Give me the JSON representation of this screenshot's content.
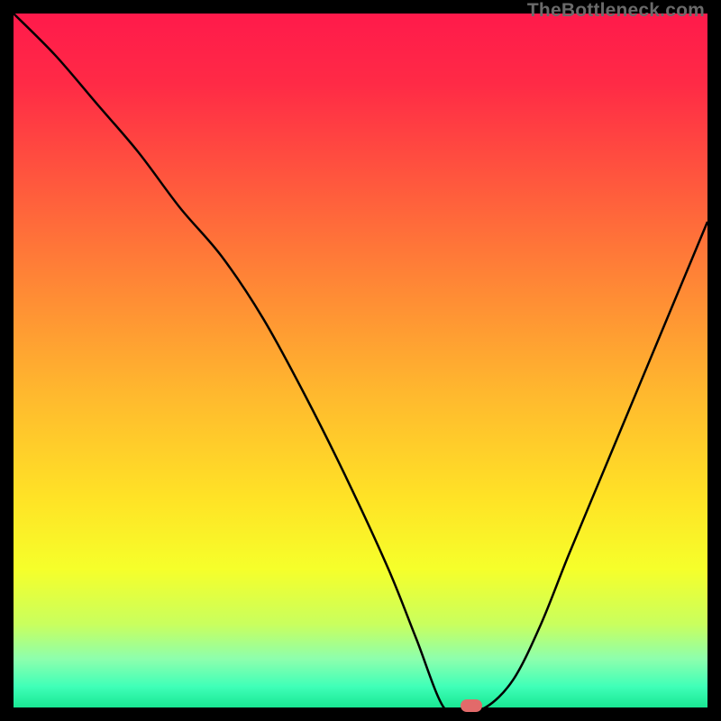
{
  "watermark": "TheBottleneck.com",
  "colors": {
    "background": "#000000",
    "gradient_stops": [
      {
        "offset": 0.0,
        "color": "#ff1a4b"
      },
      {
        "offset": 0.1,
        "color": "#ff2a46"
      },
      {
        "offset": 0.25,
        "color": "#ff5a3d"
      },
      {
        "offset": 0.4,
        "color": "#ff8a35"
      },
      {
        "offset": 0.55,
        "color": "#ffb92e"
      },
      {
        "offset": 0.7,
        "color": "#ffe326"
      },
      {
        "offset": 0.8,
        "color": "#f6ff2a"
      },
      {
        "offset": 0.88,
        "color": "#c9ff5e"
      },
      {
        "offset": 0.93,
        "color": "#8dffad"
      },
      {
        "offset": 0.97,
        "color": "#3fffb8"
      },
      {
        "offset": 1.0,
        "color": "#19e793"
      }
    ],
    "curve": "#000000",
    "marker": "#e26a6a"
  },
  "chart_data": {
    "type": "line",
    "title": "",
    "xlabel": "",
    "ylabel": "",
    "xlim": [
      0,
      100
    ],
    "ylim": [
      0,
      100
    ],
    "series": [
      {
        "name": "bottleneck-curve",
        "x": [
          0,
          6,
          12,
          18,
          24,
          30,
          36,
          42,
          48,
          54,
          58,
          62,
          65,
          68,
          72,
          76,
          80,
          85,
          90,
          95,
          100
        ],
        "y": [
          100,
          94,
          87,
          80,
          72,
          65,
          56,
          45,
          33,
          20,
          10,
          3,
          0,
          0,
          4,
          12,
          22,
          34,
          46,
          58,
          70
        ]
      }
    ],
    "marker": {
      "x": 66.0,
      "y": 0.0
    },
    "flat_bottom_x": [
      62,
      69
    ]
  }
}
